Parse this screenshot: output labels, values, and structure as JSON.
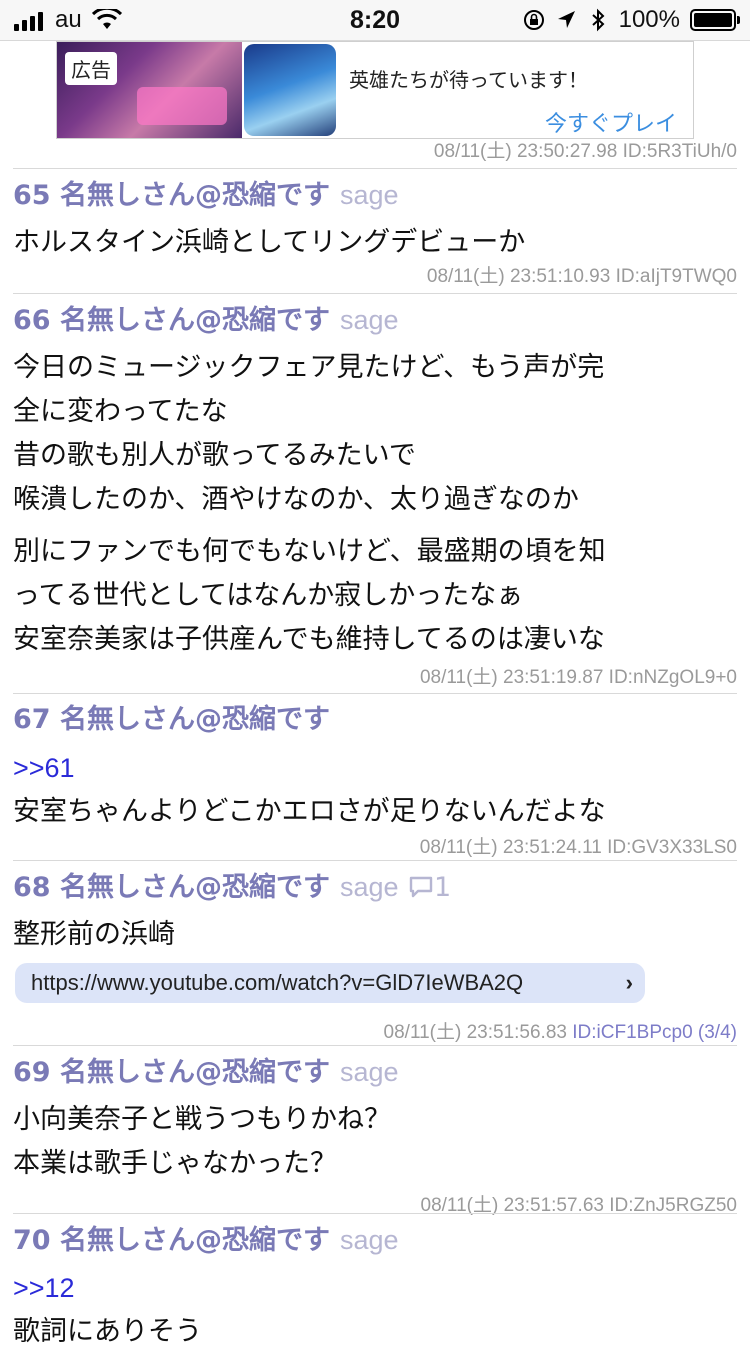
{
  "status_bar": {
    "carrier": "au",
    "time": "8:20",
    "battery": "100%"
  },
  "ad": {
    "tag": "広告",
    "text": "英雄たちが待っています！",
    "cta": "今すぐプレイ"
  },
  "posts": [
    {
      "meta": "08/11(土) 23:50:27.98 ID:5R3TiUh/0"
    },
    {
      "number": "65",
      "name": "名無しさん@恐縮です",
      "sage": "sage",
      "lines": [
        "ホルスタイン浜崎としてリングデビューか"
      ],
      "meta": "08/11(土) 23:51:10.93 ID:aIjT9TWQ0"
    },
    {
      "number": "66",
      "name": "名無しさん@恐縮です",
      "sage": "sage",
      "lines": [
        "今日のミュージックフェア見たけど、もう声が完",
        "全に変わってたな",
        "昔の歌も別人が歌ってるみたいで",
        "喉潰したのか、酒やけなのか、太り過ぎなのか",
        "別にファンでも何でもないけど、最盛期の頃を知",
        "ってる世代としてはなんか寂しかったなぁ",
        "安室奈美家は子供産んでも維持してるのは凄いな"
      ],
      "meta": "08/11(土) 23:51:19.87 ID:nNZgOL9+0"
    },
    {
      "number": "67",
      "name": "名無しさん@恐縮です",
      "anchor": ">>61",
      "lines": [
        "安室ちゃんよりどこかエロさが足りないんだよな"
      ],
      "meta": "08/11(土) 23:51:24.11 ID:GV3X33LS0"
    },
    {
      "number": "68",
      "name": "名無しさん@恐縮です",
      "sage": "sage",
      "reply_count": "1",
      "lines": [
        "整形前の浜崎"
      ],
      "link": "https://www.youtube.com/watch?v=GlD7IeWBA2Q",
      "meta_date": "08/11(土) 23:51:56.83",
      "meta_id": "ID:iCF1BPcp0 (3/4)"
    },
    {
      "number": "69",
      "name": "名無しさん@恐縮です",
      "sage": "sage",
      "lines": [
        "小向美奈子と戦うつもりかね？",
        "本業は歌手じゃなかった？"
      ],
      "meta": "08/11(土) 23:51:57.63 ID:ZnJ5RGZ50"
    },
    {
      "number": "70",
      "name": "名無しさん@恐縮です",
      "sage": "sage",
      "anchor": ">>12",
      "lines": [
        "歌詞にありそう"
      ]
    }
  ]
}
